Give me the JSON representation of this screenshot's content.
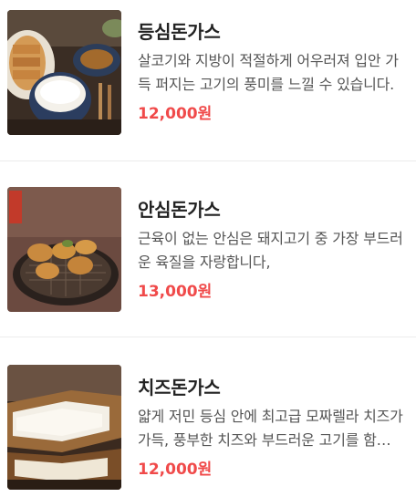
{
  "menu_items": [
    {
      "name": "등심돈가스",
      "description": "살코기와 지방이 적절하게 어우러져 입안 가득 퍼지는 고기의 풍미를 느낄 수 있습니다.",
      "price": "12,000원",
      "image": "pork-loin-cutlet-set-photo"
    },
    {
      "name": "안심돈가스",
      "description": "근육이 없는 안심은 돼지고기 중 가장 부드러운 육질을 자랑합니다,",
      "price": "13,000원",
      "image": "pork-tenderloin-cutlet-photo"
    },
    {
      "name": "치즈돈가스",
      "description": "얇게 저민 등심 안에 최고급 모짜렐라 치즈가 가득, 풍부한 치즈와 부드러운 고기를 함께 즐기세요.",
      "price": "12,000원",
      "image": "cheese-cutlet-photo"
    }
  ],
  "colors": {
    "price": "#f04a4a",
    "title": "#222222",
    "description": "#555555",
    "divider": "#ececec"
  }
}
